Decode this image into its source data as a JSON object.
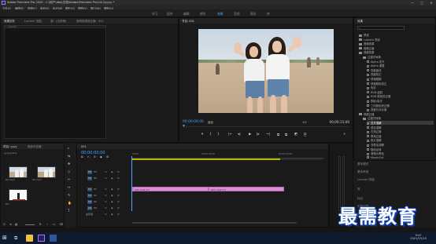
{
  "window": {
    "title": "Adobe Premiere Pro 2020 - C:\\用户\\dbq\\文档\\Adobe\\Premiere Pro\\14.0\\yyyy *",
    "controls": [
      "—",
      "□",
      "✕"
    ]
  },
  "menu": [
    "文件(F)",
    "编辑(E)",
    "剪辑(C)",
    "序列(S)",
    "标记(M)",
    "图形(G)",
    "视图(V)",
    "窗口(W)",
    "帮助(H)"
  ],
  "workspaces": [
    "学习",
    "组件",
    "编辑",
    "颜色",
    "效果",
    "音频",
    "图形",
    "库"
  ],
  "workspace_active": "效果",
  "source_panel": {
    "tabs": [
      "效果控件",
      "Lumetri 范围",
      "源：(无剪辑)",
      "音频剪辑混合器：001"
    ],
    "field": "（无剪辑）"
  },
  "program": {
    "tab": "节目: 001",
    "timecode": "00;00;00;00",
    "fit": "适合",
    "quality": "1/2",
    "duration": "00;00;15;00",
    "transport": [
      "▾",
      "{",
      "}",
      "|←",
      "◂|",
      "▶",
      "|▸",
      "→|",
      "⧉",
      "⧉",
      "◩",
      "⎘",
      "+"
    ]
  },
  "effects": {
    "tab": "效果",
    "items": [
      {
        "label": "预设",
        "kind": "folder",
        "indent": 0
      },
      {
        "label": "Lumetri 预设",
        "kind": "folder",
        "indent": 0
      },
      {
        "label": "音频效果",
        "kind": "folder",
        "indent": 0
      },
      {
        "label": "音频过渡",
        "kind": "folder",
        "indent": 0
      },
      {
        "label": "视频效果",
        "kind": "folder",
        "indent": 0
      },
      {
        "label": "过渡式转换",
        "kind": "folder",
        "indent": 1
      },
      {
        "label": "Alpha 发光",
        "kind": "fx",
        "indent": 2
      },
      {
        "label": "Alpha 调整",
        "kind": "fx",
        "indent": 2
      },
      {
        "label": "亮度曲线",
        "kind": "fx",
        "indent": 2
      },
      {
        "label": "亮度校正",
        "kind": "fx",
        "indent": 2
      },
      {
        "label": "快速模糊",
        "kind": "fx",
        "indent": 2
      },
      {
        "label": "快速颜色校正",
        "kind": "fx",
        "indent": 2
      },
      {
        "label": "色彩",
        "kind": "fx",
        "indent": 2
      },
      {
        "label": "RGB 曲线",
        "kind": "fx",
        "indent": 2
      },
      {
        "label": "RGB 颜色校正器",
        "kind": "fx",
        "indent": 2
      },
      {
        "label": "阴影/高光",
        "kind": "fx",
        "indent": 2
      },
      {
        "label": "三向颜色校正器",
        "kind": "fx",
        "indent": 2
      },
      {
        "label": "亮度与对比度",
        "kind": "fx",
        "indent": 2
      },
      {
        "label": "视频过渡",
        "kind": "folder",
        "indent": 0
      },
      {
        "label": "过渡式转换",
        "kind": "folder",
        "indent": 1
      },
      {
        "label": "交叉溶解",
        "kind": "fx",
        "indent": 2,
        "selected": true
      },
      {
        "label": "叠加溶解",
        "kind": "fx",
        "indent": 2
      },
      {
        "label": "白场过渡",
        "kind": "fx",
        "indent": 2
      },
      {
        "label": "黑场过渡",
        "kind": "fx",
        "indent": 2
      },
      {
        "label": "胶片溶解",
        "kind": "fx",
        "indent": 2
      },
      {
        "label": "非叠加溶解",
        "kind": "fx",
        "indent": 2
      },
      {
        "label": "随机反转",
        "kind": "fx",
        "indent": 2
      },
      {
        "label": "渐隐为黑色",
        "kind": "fx",
        "indent": 2
      },
      {
        "label": "MorphCut",
        "kind": "fx",
        "indent": 2
      }
    ]
  },
  "right_lower": [
    "基本图形",
    "基本声音",
    "Lumetri 颜色",
    "库",
    "标记",
    "历史记录",
    "信息"
  ],
  "project": {
    "tabs": [
      "项目: yyyy",
      "媒体浏览器"
    ],
    "path": "yyyy.prproj",
    "items": [
      {
        "label": "001.mp4"
      },
      {
        "label": "001.mp4"
      },
      {
        "label": "001"
      }
    ]
  },
  "tools": [
    "▸",
    "⇆",
    "✥",
    "◇",
    "✂",
    "↔",
    "✎",
    "✋",
    "T"
  ],
  "timeline": {
    "tab": "001",
    "timecode": "00;00;00;00",
    "ruler": [
      "00;00",
      "00;00;05;00",
      "00;00;10;00"
    ],
    "tracks": [
      {
        "tag": "V3",
        "name": "V3"
      },
      {
        "tag": "V2",
        "name": "V2"
      },
      {
        "tag": "V1",
        "name": "V1"
      },
      {
        "tag": "A1",
        "name": "A1"
      },
      {
        "tag": "A2",
        "name": "A2"
      },
      {
        "tag": "A3",
        "name": "A3"
      },
      {
        "tag": "",
        "name": "主声道"
      }
    ],
    "clips": [
      {
        "label": "001.mp4 [V]"
      },
      {
        "label": "001.mp4 [V]"
      }
    ]
  },
  "taskbar": {
    "time": "9:47",
    "date": "2021/10/15"
  },
  "watermark": "最需教育",
  "colors": {
    "accent": "#3da8ff",
    "clip": "#d98fd6",
    "workarea": "#b7b700"
  }
}
